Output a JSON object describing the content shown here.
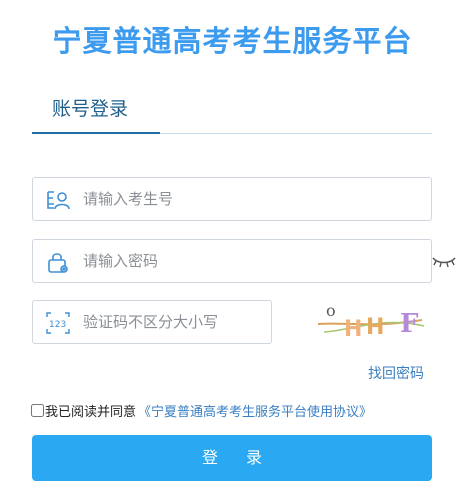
{
  "title": "宁夏普通高考考生服务平台",
  "tab": {
    "label": "账号登录"
  },
  "fields": {
    "username_placeholder": "请输入考生号",
    "password_placeholder": "请输入密码",
    "captcha_placeholder": "验证码不区分大小写"
  },
  "captcha_text": "OHHF",
  "forgot_label": "找回密码",
  "agreement": {
    "text": "我已阅读并同意",
    "link": "《宁夏普通高考考生服务平台使用协议》"
  },
  "login_label": "登录",
  "colors": {
    "title": "#3d9bef",
    "button": "#2aa8f2",
    "link": "#3a7fc1"
  },
  "icons": [
    "user-card-icon",
    "lock-icon",
    "captcha-123-icon",
    "eye-closed-icon"
  ]
}
